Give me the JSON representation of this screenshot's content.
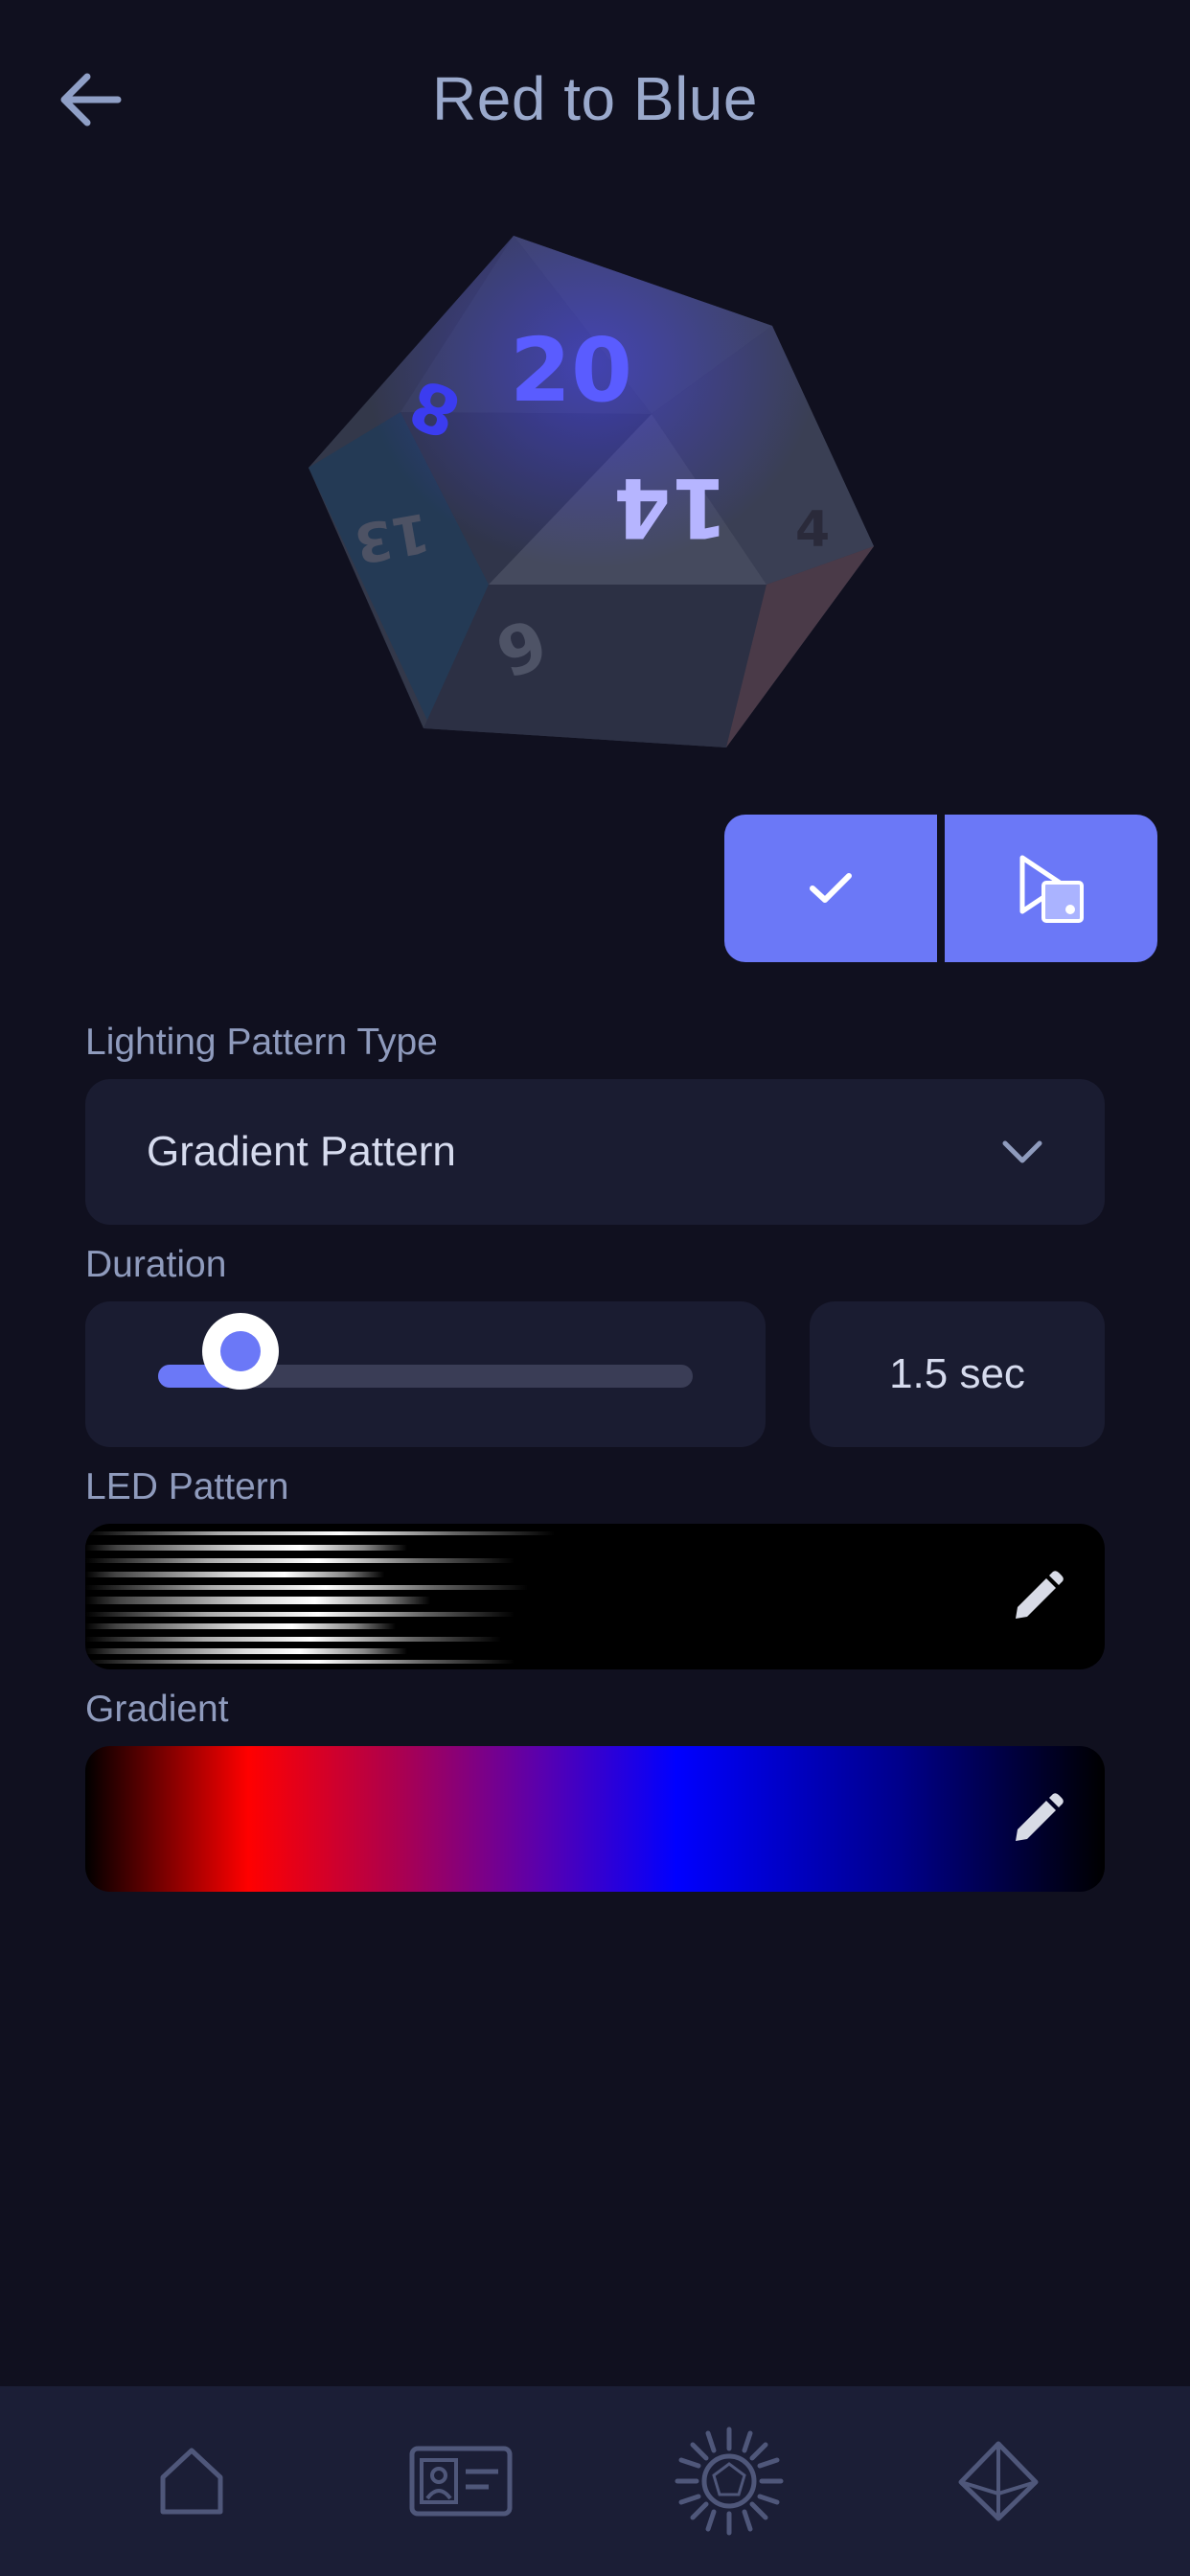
{
  "header": {
    "title": "Red to Blue",
    "back_icon": "arrow-left-icon"
  },
  "die": {
    "image": "d20-die-render",
    "faces": [
      "20",
      "14",
      "8",
      "13",
      "9",
      "4"
    ]
  },
  "actions": {
    "confirm_icon": "check-icon",
    "preview_icon": "play-on-die-icon"
  },
  "lighting_pattern": {
    "label": "Lighting Pattern Type",
    "value": "Gradient Pattern",
    "icon": "chevron-down-icon"
  },
  "duration": {
    "label": "Duration",
    "value_text": "1.5 sec",
    "slider_fraction": 0.14
  },
  "led_pattern": {
    "label": "LED Pattern",
    "edit_icon": "pencil-icon"
  },
  "gradient": {
    "label": "Gradient",
    "edit_icon": "pencil-icon",
    "colors": [
      "#000000",
      "#ff0000",
      "#b0004a",
      "#5800b0",
      "#0000ff",
      "#00008a",
      "#000000"
    ]
  },
  "nav": {
    "items": [
      {
        "name": "home",
        "icon": "home-icon"
      },
      {
        "name": "profile",
        "icon": "id-card-icon"
      },
      {
        "name": "lighting",
        "icon": "sun-die-icon"
      },
      {
        "name": "dice",
        "icon": "diamond-die-icon"
      }
    ]
  },
  "colors": {
    "background": "#10101f",
    "card": "#1a1c31",
    "accent": "#6b78f7",
    "nav_background": "#1b1e36"
  }
}
